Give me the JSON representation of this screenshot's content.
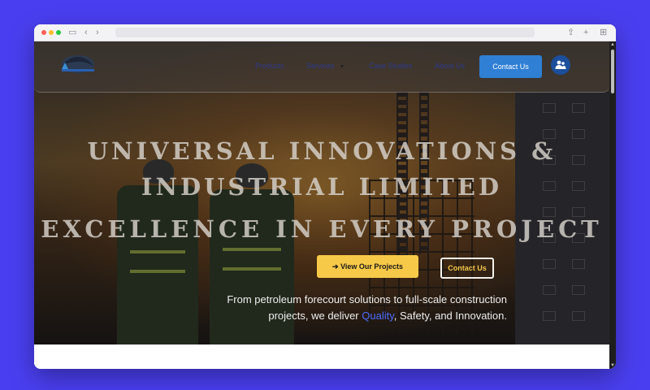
{
  "nav": {
    "links": [
      "Products",
      "Services",
      "Case Studies",
      "About Us"
    ],
    "contact_label": "Contact Us",
    "user_icon": "user-group-icon"
  },
  "hero": {
    "title_line1": "UNIVERSAL INNOVATIONS &",
    "title_line2": "INDUSTRIAL LIMITED",
    "headline": "EXCELLENCE IN EVERY PROJECT",
    "primary_button": "➔ View Our Projects",
    "secondary_button": "Contact Us",
    "tagline_line1": "From petroleum forecourt solutions to full-scale construction",
    "tagline_line2_pre": "projects, we deliver ",
    "tagline_highlight": "Quality",
    "tagline_line2_post": ", Safety, and Innovation."
  },
  "colors": {
    "page_background": "#4a3ff0",
    "accent_blue": "#2f7fd4",
    "button_yellow": "#f7c948",
    "highlight": "#4f6dff"
  }
}
